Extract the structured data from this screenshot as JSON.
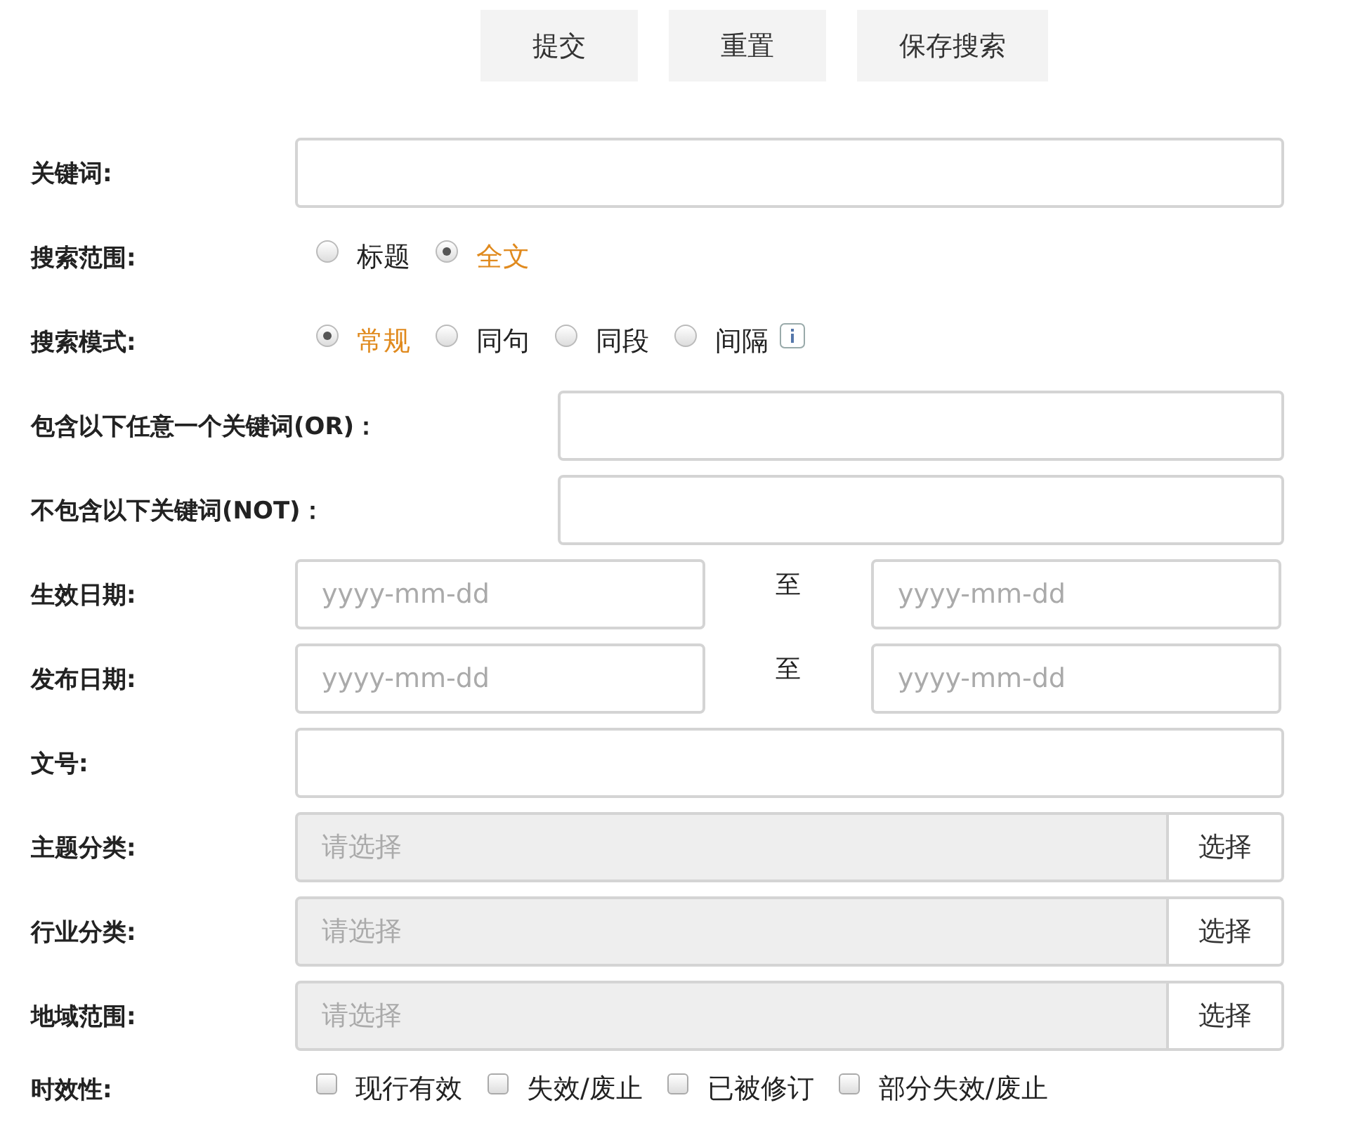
{
  "buttons": [
    "提交",
    "重置",
    "保存搜索"
  ],
  "rows": [
    {
      "kind": "text",
      "label": "关键词:"
    },
    {
      "kind": "radio",
      "label": "搜索范围:",
      "options": [
        {
          "label": "标题",
          "selected": false
        },
        {
          "label": "全文",
          "selected": true
        }
      ]
    },
    {
      "kind": "radio",
      "label": "搜索模式:",
      "info_icon": true,
      "options": [
        {
          "label": "常规",
          "selected": true
        },
        {
          "label": "同句",
          "selected": false
        },
        {
          "label": "同段",
          "selected": false
        },
        {
          "label": "间隔",
          "selected": false
        }
      ]
    },
    {
      "kind": "text_long",
      "label": "包含以下任意一个关键词(OR)："
    },
    {
      "kind": "text_long",
      "label": "不包含以下关键词(NOT)："
    },
    {
      "kind": "date_range",
      "label": "生效日期:",
      "from_placeholder": "yyyy-mm-dd",
      "separator": "至",
      "to_placeholder": "yyyy-mm-dd"
    },
    {
      "kind": "date_range",
      "label": "发布日期:",
      "from_placeholder": "yyyy-mm-dd",
      "separator": "至",
      "to_placeholder": "yyyy-mm-dd"
    },
    {
      "kind": "text",
      "label": "文号:"
    },
    {
      "kind": "select",
      "label": "主题分类:",
      "placeholder": "请选择",
      "button": "选择"
    },
    {
      "kind": "select",
      "label": "行业分类:",
      "placeholder": "请选择",
      "button": "选择"
    },
    {
      "kind": "select",
      "label": "地域范围:",
      "placeholder": "请选择",
      "button": "选择"
    },
    {
      "kind": "checkbox",
      "label": "时效性:",
      "options": [
        {
          "label": "现行有效",
          "checked": false
        },
        {
          "label": "失效/废止",
          "checked": false
        },
        {
          "label": "已被修订",
          "checked": false
        },
        {
          "label": "部分失效/废止",
          "checked": false
        }
      ]
    }
  ]
}
